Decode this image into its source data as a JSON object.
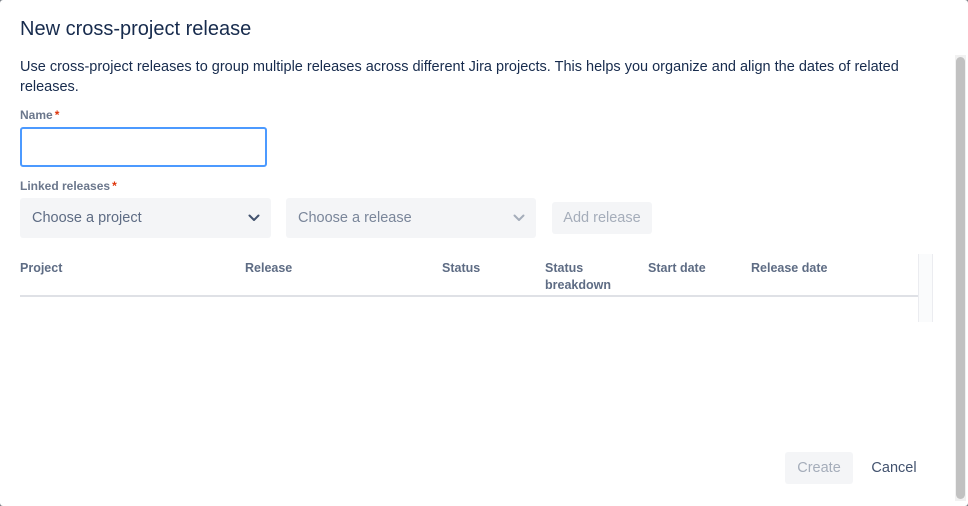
{
  "dialog": {
    "title": "New cross-project release",
    "description": "Use cross-project releases to group multiple releases across different Jira projects. This helps you organize and align the dates of related releases."
  },
  "form": {
    "name_label": "Name",
    "name_value": "",
    "required_marker": "*",
    "linked_label": "Linked releases",
    "project_placeholder": "Choose a project",
    "release_placeholder": "Choose a release",
    "add_release_label": "Add release"
  },
  "table": {
    "columns": {
      "project": "Project",
      "release": "Release",
      "status": "Status",
      "status_breakdown": "Status breakdown",
      "start_date": "Start date",
      "release_date": "Release date"
    },
    "rows": []
  },
  "footer": {
    "create_label": "Create",
    "cancel_label": "Cancel"
  },
  "colors": {
    "focus_border": "#4c9aff",
    "required": "#de350b",
    "text": "#172b4d",
    "disabled_text": "#a5adba"
  },
  "icons": [
    "chevron-down-icon",
    "chevron-down-icon"
  ]
}
